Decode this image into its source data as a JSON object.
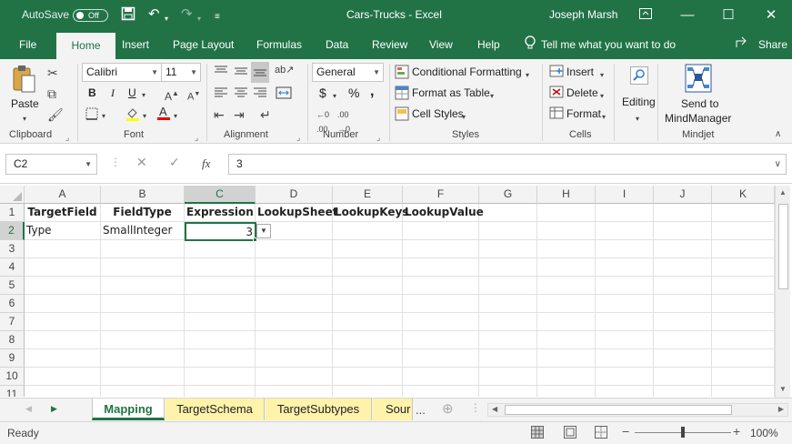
{
  "titlebar": {
    "autosave_label": "AutoSave",
    "autosave_state": "Off",
    "title": "Cars-Trucks  -  Excel",
    "user": "Joseph Marsh"
  },
  "tabs": [
    "File",
    "Home",
    "Insert",
    "Page Layout",
    "Formulas",
    "Data",
    "Review",
    "View",
    "Help"
  ],
  "tell_me": "Tell me what you want to do",
  "share": "Share",
  "ribbon": {
    "clipboard": {
      "paste": "Paste",
      "label": "Clipboard"
    },
    "font": {
      "name": "Calibri",
      "size": "11",
      "bold": "B",
      "italic": "I",
      "underline": "U",
      "label": "Font"
    },
    "alignment": {
      "label": "Alignment"
    },
    "number": {
      "format": "General",
      "currency": "$",
      "percent": "%",
      "comma": ",",
      "label": "Number"
    },
    "styles": {
      "conditional": "Conditional Formatting",
      "format_table": "Format as Table",
      "cell_styles": "Cell Styles",
      "label": "Styles"
    },
    "cells": {
      "insert": "Insert",
      "delete": "Delete",
      "format": "Format",
      "label": "Cells"
    },
    "editing": {
      "label": "Editing"
    },
    "mindjet": {
      "send_line1": "Send to",
      "send_line2": "MindManager",
      "label": "Mindjet"
    }
  },
  "formula_bar": {
    "name_box": "C2",
    "fx": "fx",
    "value": "3"
  },
  "columns": [
    "A",
    "B",
    "C",
    "D",
    "E",
    "F",
    "G",
    "H",
    "I",
    "J",
    "K"
  ],
  "rows": [
    "1",
    "2",
    "3",
    "4",
    "5",
    "6",
    "7",
    "8",
    "9",
    "10",
    "11"
  ],
  "cells": {
    "A1": "TargetField",
    "B1": "FieldType",
    "C1": "Expression",
    "D1": "LookupSheet",
    "E1": "LookupKeys",
    "F1": "LookupValue",
    "A2": "Type",
    "B2": "SmallInteger",
    "C2": "3"
  },
  "sheets": [
    "Mapping",
    "TargetSchema",
    "TargetSubtypes",
    "Sour"
  ],
  "sheet_more": "...",
  "status": {
    "text": "Ready",
    "zoom": "100%"
  },
  "colors": {
    "accent": "#217346",
    "sheet_tab": "#fff2ab"
  },
  "icons": [
    "save-icon",
    "undo-icon",
    "redo-icon",
    "lightbulb-icon",
    "share-icon",
    "paste-icon",
    "cut-icon",
    "copy-icon",
    "format-painter-icon",
    "search-icon",
    "mindmanager-icon"
  ]
}
